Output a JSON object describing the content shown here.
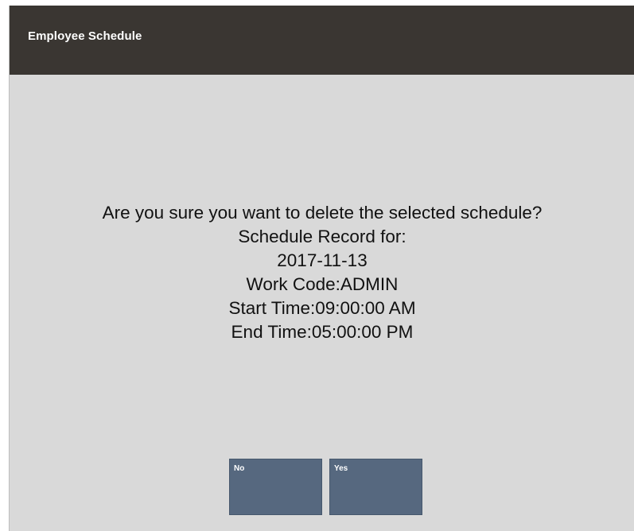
{
  "window": {
    "title": "Employee Schedule"
  },
  "dialog": {
    "question": "Are you sure you want to delete the selected schedule?",
    "record_heading": "Schedule Record for:",
    "date": "2017-11-13",
    "work_code": "Work Code:ADMIN",
    "start_time": "Start Time:09:00:00 AM",
    "end_time": "End Time:05:00:00 PM"
  },
  "buttons": {
    "no_label": "No",
    "yes_label": "Yes"
  },
  "colors": {
    "title_bar": "#3a3632",
    "background": "#d9d9d9",
    "button": "#56687f"
  }
}
